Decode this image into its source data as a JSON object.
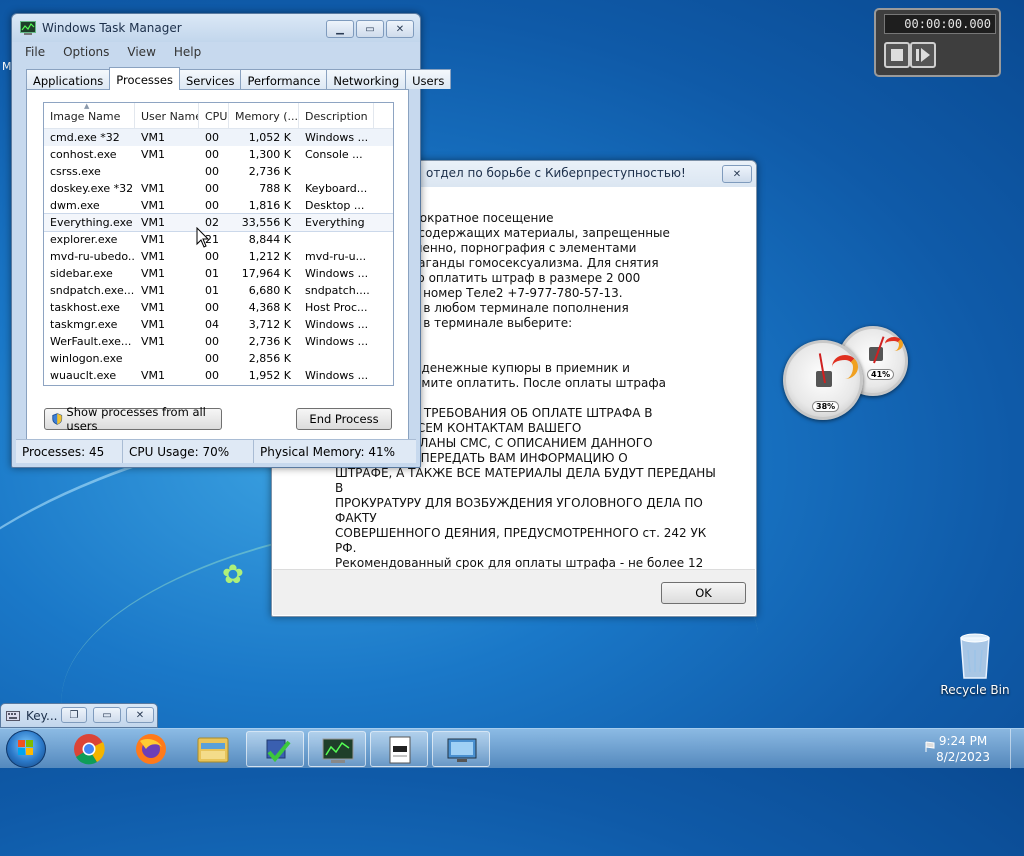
{
  "colors": {
    "desktop": "#1a78c8",
    "taskbar": "#6fa2cf",
    "window_frame": "#c7d9ee"
  },
  "desktop_edge_label": "M",
  "task_manager": {
    "title": "Windows Task Manager",
    "menu": [
      "File",
      "Options",
      "View",
      "Help"
    ],
    "tabs": [
      "Applications",
      "Processes",
      "Services",
      "Performance",
      "Networking",
      "Users"
    ],
    "active_tab": "Processes",
    "columns": [
      "Image Name",
      "User Name",
      "CPU",
      "Memory (...",
      "Description"
    ],
    "rows": [
      [
        "cmd.exe *32",
        "VM1",
        "00",
        "1,052 K",
        "Windows ..."
      ],
      [
        "conhost.exe",
        "VM1",
        "00",
        "1,300 K",
        "Console ..."
      ],
      [
        "csrss.exe",
        "",
        "00",
        "2,736 K",
        ""
      ],
      [
        "doskey.exe *32",
        "VM1",
        "00",
        "788 K",
        "Keyboard..."
      ],
      [
        "dwm.exe",
        "VM1",
        "00",
        "1,816 K",
        "Desktop ..."
      ],
      [
        "Everything.exe",
        "VM1",
        "02",
        "33,556 K",
        "Everything"
      ],
      [
        "explorer.exe",
        "VM1",
        "21",
        "8,844 K",
        ""
      ],
      [
        "mvd-ru-ubedo...",
        "VM1",
        "00",
        "1,212 K",
        "mvd-ru-u..."
      ],
      [
        "sidebar.exe",
        "VM1",
        "01",
        "17,964 K",
        "Windows ..."
      ],
      [
        "sndpatch.exe...",
        "VM1",
        "01",
        "6,680 K",
        "sndpatch...."
      ],
      [
        "taskhost.exe",
        "VM1",
        "00",
        "4,368 K",
        "Host Proc..."
      ],
      [
        "taskmgr.exe",
        "VM1",
        "04",
        "3,712 K",
        "Windows ..."
      ],
      [
        "WerFault.exe...",
        "VM1",
        "00",
        "2,736 K",
        "Windows ..."
      ],
      [
        "winlogon.exe",
        "",
        "00",
        "2,856 K",
        ""
      ],
      [
        "wuauclt.exe",
        "VM1",
        "00",
        "1,952 K",
        "Windows ..."
      ]
    ],
    "show_all_label": "Show processes from all users",
    "end_process_label": "End Process",
    "status": {
      "processes": "Processes: 45",
      "cpu": "CPU Usage: 70%",
      "memory": "Physical Memory: 41%"
    }
  },
  "ransom_dialog": {
    "title": "отдел по борьбе с Киберпреступностью!",
    "lines": [
      "аны за неоднократное посещение",
      "ских сайтов, содержащих материалы, запрещенные",
      "твом РФ, а именно, порнография с элементами",
      "силия и пропаганды гомосексуализма. Для снятия",
      "м необходимо оплатить штраф в размере 2 000",
      "дарственный номер Теле2 +7-977-780-57-13.",
      "ф Вы можете в любом терминале пополнения",
      "зи. Для этого в терминале выберите:",
      "",
      "мер:",
      "-13 - внесите денежные купюры в приемник и",
      "рублей и нажмите оплатить. После оплаты штрафа",
      "дет снята.",
      "ОРИРОВАНИЯ ТРЕБОВАНИЯ ОБ ОПЛАТЕ ШТРАФА В",
      "НЫЙ СРОК, ВСЕМ КОНТАКТАМ ВАШЕГО",
      "БУДУТ РАЗОСЛАНЫ СМС, С ОПИСАНИЕМ ДАННОГО",
      "И ПРОСЬБОЙ ПЕРЕДАТЬ ВАМ ИНФОРМАЦИЮ О",
      "ШТРАФЕ, А ТАКЖЕ ВСЕ МАТЕРИАЛЫ ДЕЛА БУДУТ ПЕРЕДАНЫ В",
      "ПРОКУРАТУРУ ДЛЯ ВОЗБУЖДЕНИЯ УГОЛОВНОГО ДЕЛА ПО ФАКТУ",
      "СОВЕРШЕННОГО ДЕЯНИЯ, ПРЕДУСМОТРЕННОГО ст. 242 УК РФ.",
      "Рекомендованный срок для оплаты штрафа - не более 12 часов с",
      "момента уведомления!"
    ],
    "ok_label": "OK"
  },
  "stopwatch": {
    "time": "00:00:00.000"
  },
  "gauges": {
    "cpu": "38%",
    "memory": "41%"
  },
  "recycle_bin": {
    "label": "Recycle Bin"
  },
  "minimized_window": {
    "title": "Key..."
  },
  "taskbar": {
    "items": [
      "start-orb-icon",
      "chrome-icon",
      "firefox-icon",
      "explorer-folder-icon",
      "security-shield-icon",
      "task-manager-icon",
      "document-icon",
      "remote-desktop-icon"
    ],
    "time": "9:24 PM",
    "date": "8/2/2023"
  }
}
